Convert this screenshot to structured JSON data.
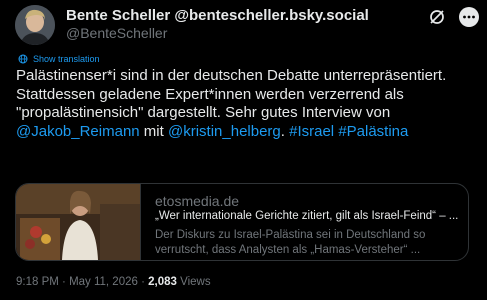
{
  "author": {
    "name": "Bente Scheller",
    "verified_handle": "@bentescheller.bsky.social",
    "handle": "@BenteScheller"
  },
  "translate": {
    "label": "Show translation",
    "icon": "globe-icon"
  },
  "post": {
    "line1": "Palästinenser*i sind in der deutschen Debatte unterrepräsentiert.",
    "line2": "Stattdessen geladene Expert*innen werden verzerrend als",
    "line3_a": "\"propalästinensich\" dargestellt.  Sehr gutes Interview von",
    "mention1": "@Jakob_Reimann",
    "mit": " mit ",
    "mention2": "@kristin_helberg",
    "dot": ". ",
    "hashtag1": "#Israel",
    "hashtag2": "#Palästina"
  },
  "card": {
    "domain": "etosmedia.de",
    "title": "„Wer internationale Gerichte zitiert, gilt als Israel-Feind“ – ...",
    "description": "Der Diskurs zu Israel-Palästina sei in Deutschland so verrutscht, dass Analysten als „Hamas-Versteher“ ..."
  },
  "meta": {
    "time": "9:18 PM",
    "sep1": " · ",
    "date": "May 11, 2026",
    "sep2": " · ",
    "views_count": "2,083",
    "views_label": " Views"
  },
  "colors": {
    "background": "#000000",
    "text": "#e7e9ea",
    "secondary": "#71767b",
    "link": "#1d9bf0",
    "border": "#2f3336"
  }
}
